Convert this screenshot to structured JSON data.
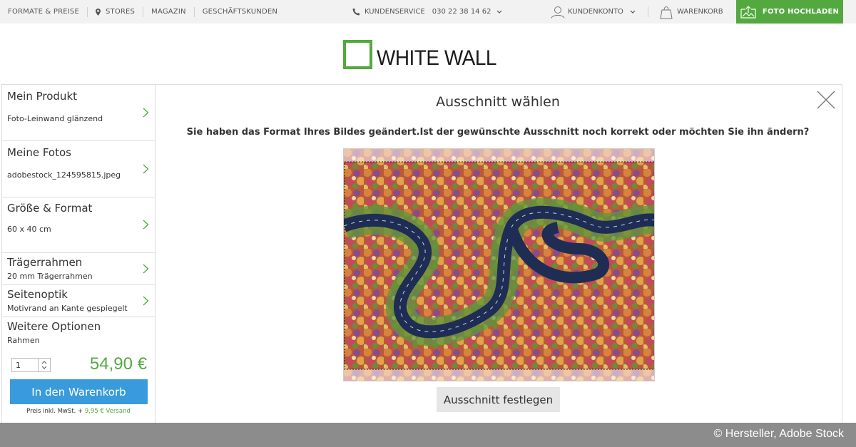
{
  "topnav": {
    "items": [
      "FORMATE & PREISE",
      "STORES",
      "MAGAZIN",
      "GESCHÄFTSKUNDEN"
    ],
    "service_label": "KUNDENSERVICE",
    "service_phone": "030 22 38 14 62",
    "account_label": "KUNDENKONTO",
    "cart_label": "WARENKORB",
    "upload_label": "FOTO HOCHLADEN"
  },
  "logo": {
    "text": "WHITE WALL",
    "color": "#53a93f"
  },
  "sidebar": {
    "options": [
      {
        "title": "Mein Produkt",
        "subtitle": "Foto-Leinwand glänzend"
      },
      {
        "title": "Meine Fotos",
        "subtitle": "adobestock_124595815.jpeg"
      },
      {
        "title": "Größe & Format",
        "subtitle": "60 x 40 cm"
      },
      {
        "title": "Trägerrahmen",
        "subtitle": "20 mm Trägerrahmen"
      },
      {
        "title": "Seitenoptik",
        "subtitle": "Motivrand an Kante gespiegelt"
      },
      {
        "title": "Weitere Optionen",
        "subtitle": "Rahmen"
      }
    ],
    "quantity": "1",
    "price": "54,90 €",
    "add_to_cart": "In den Warenkorb",
    "price_info": "Preis inkl. MwSt. +",
    "shipping": "9,95 € Versand"
  },
  "dialog": {
    "title": "Ausschnitt wählen",
    "message": "Sie haben das Format Ihres Bildes geändert.Ist der gewünschte Ausschnitt noch korrekt oder möchten Sie ihn ändern?",
    "confirm_button": "Ausschnitt festlegen"
  },
  "credit": "© Hersteller, Adobe Stock",
  "colors": {
    "accent_green": "#53a93f",
    "button_blue": "#3a9bdc"
  }
}
